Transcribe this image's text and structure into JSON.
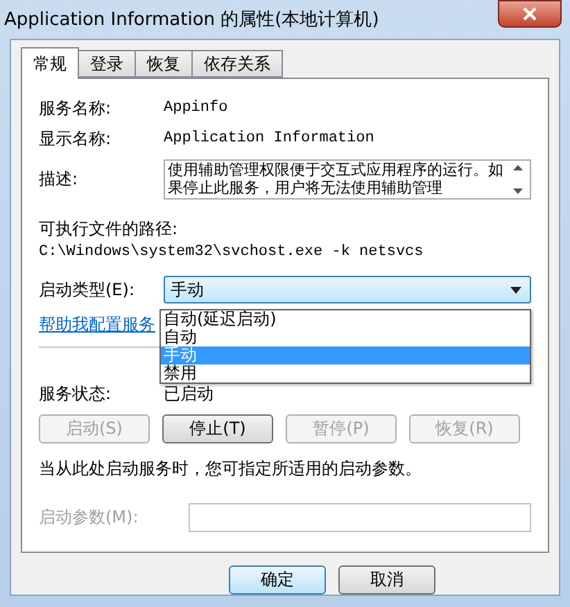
{
  "window": {
    "title": "Application Information 的属性(本地计算机)"
  },
  "tabs": [
    {
      "label": "常规",
      "selected": true
    },
    {
      "label": "登录",
      "selected": false
    },
    {
      "label": "恢复",
      "selected": false
    },
    {
      "label": "依存关系",
      "selected": false
    }
  ],
  "general": {
    "service_name": {
      "label": "服务名称:",
      "value": "Appinfo"
    },
    "display_name": {
      "label": "显示名称:",
      "value": "Application Information"
    },
    "description": {
      "label": "描述:",
      "value": "使用辅助管理权限便于交互式应用程序的运行。如果停止此服务，用户将无法使用辅助管理"
    },
    "path": {
      "label": "可执行文件的路径:",
      "value": "C:\\Windows\\system32\\svchost.exe -k netsvcs"
    },
    "startup_type": {
      "label": "启动类型(E):",
      "value": "手动",
      "expanded": true,
      "options": [
        {
          "label": "自动(延迟启动)",
          "selected": false
        },
        {
          "label": "自动",
          "selected": false
        },
        {
          "label": "手动",
          "selected": true
        },
        {
          "label": "禁用",
          "selected": false
        }
      ]
    },
    "help_link": "帮助我配置服务",
    "service_status": {
      "label": "服务状态:",
      "value": "已启动"
    },
    "service_buttons": [
      {
        "label": "启动(S)",
        "disabled": true
      },
      {
        "label": "停止(T)",
        "disabled": false
      },
      {
        "label": "暂停(P)",
        "disabled": true
      },
      {
        "label": "恢复(R)",
        "disabled": true
      }
    ],
    "hint": "当从此处启动服务时，您可指定所适用的启动参数。",
    "start_params": {
      "label": "启动参数(M):",
      "disabled": true
    }
  },
  "dialog_buttons": [
    {
      "label": "确定",
      "default": true
    },
    {
      "label": "取消",
      "default": false
    }
  ]
}
